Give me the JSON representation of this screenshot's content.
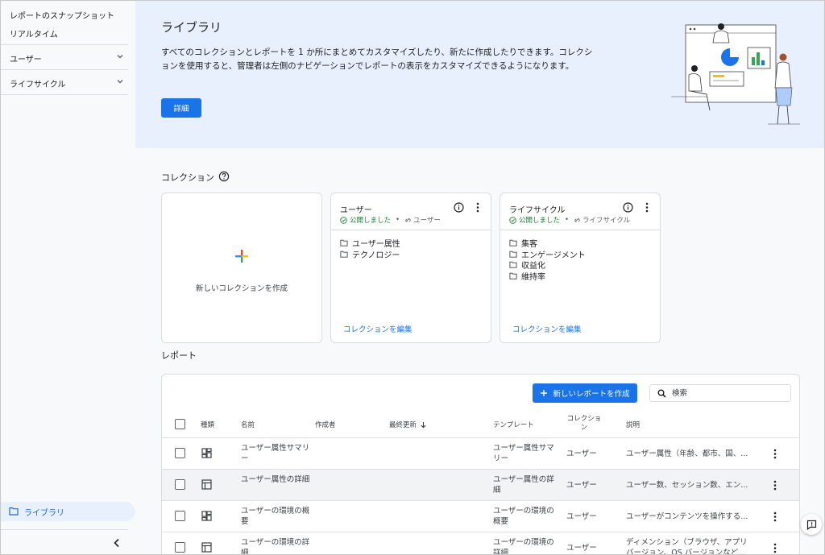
{
  "sidebar": {
    "items": [
      {
        "label": "レポートのスナップショット"
      },
      {
        "label": "リアルタイム"
      }
    ],
    "sections": [
      {
        "label": "ユーザー"
      },
      {
        "label": "ライフサイクル"
      }
    ],
    "active": {
      "label": "ライブラリ"
    }
  },
  "banner": {
    "title": "ライブラリ",
    "description": "すべてのコレクションとレポートを 1 か所にまとめてカスタマイズしたり、新たに作成したりできます。コレクションを使用すると、管理者は左側のナビゲーションでレポートの表示をカスタマイズできるようになります。",
    "button": "詳細"
  },
  "collections": {
    "title": "コレクション",
    "new_label": "新しいコレクションを作成",
    "cards": [
      {
        "title": "ユーザー",
        "status": "公開しました",
        "template": "ユーザー",
        "items": [
          "ユーザー属性",
          "テクノロジー"
        ],
        "edit": "コレクションを編集"
      },
      {
        "title": "ライフサイクル",
        "status": "公開しました",
        "template": "ライフサイクル",
        "items": [
          "集客",
          "エンゲージメント",
          "収益化",
          "維持率"
        ],
        "edit": "コレクションを編集"
      }
    ]
  },
  "reports": {
    "title": "レポート",
    "new_button": "新しいレポートを作成",
    "search_placeholder": "検索",
    "columns": [
      "種類",
      "名前",
      "作成者",
      "最終更新",
      "テンプレート",
      "コレクション",
      "説明"
    ],
    "rows": [
      {
        "type": "summary",
        "name": "ユーザー属性サマリー",
        "author": "",
        "updated": "",
        "template": "ユーザー属性サマリー",
        "collection": "ユーザー",
        "description": "ユーザー属性（年齢、都市、国、..."
      },
      {
        "type": "detail",
        "name": "ユーザー属性の詳細",
        "author": "",
        "updated": "",
        "template": "ユーザー属性の詳細",
        "collection": "ユーザー",
        "description": "ユーザー数、セッション数、エン..."
      },
      {
        "type": "summary",
        "name": "ユーザーの環境の概要",
        "author": "",
        "updated": "",
        "template": "ユーザーの環境の概要",
        "collection": "ユーザー",
        "description": "ユーザーがコンテンツを操作する..."
      },
      {
        "type": "detail",
        "name": "ユーザーの環境の詳細",
        "author": "",
        "updated": "",
        "template": "ユーザーの環境の詳細",
        "collection": "ユーザー",
        "description": "ディメンション（ブラウザ、アプリ バージョン、OS バージョンなど..."
      }
    ]
  },
  "colors": {
    "primary": "#1a73e8",
    "banner_bg": "#e8f0fe",
    "published": "#188038"
  }
}
